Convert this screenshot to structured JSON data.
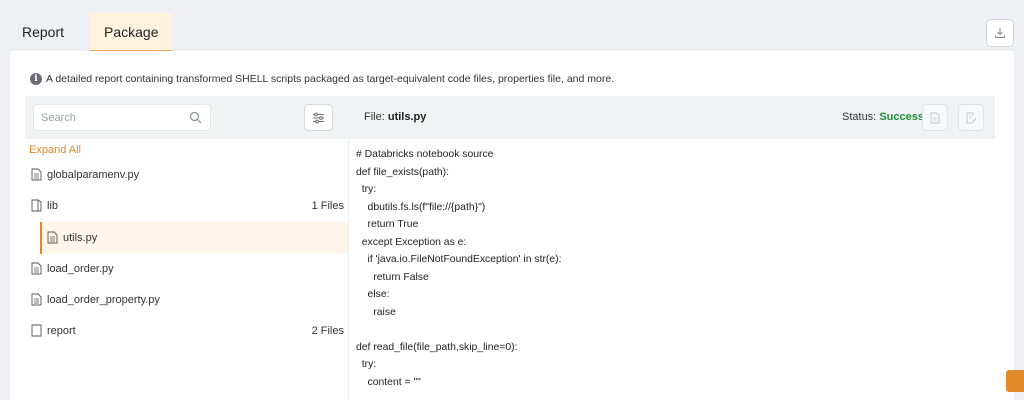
{
  "tabs": [
    {
      "label": "Report",
      "active": false
    },
    {
      "label": "Package",
      "active": true
    }
  ],
  "info_text": "A detailed report containing transformed SHELL scripts packaged as target-equivalent code files, properties file, and more.",
  "search": {
    "placeholder": "Search",
    "value": ""
  },
  "file": {
    "label": "File:",
    "name": "utils.py"
  },
  "status": {
    "label": "Status:",
    "value": "Success",
    "color": "#1f8f3a"
  },
  "tree": {
    "expand_all": "Expand All",
    "items": [
      {
        "name": "globalparamenv.py",
        "type": "file",
        "count": ""
      },
      {
        "name": "lib",
        "type": "folder",
        "count": "1 Files"
      },
      {
        "name": "utils.py",
        "type": "file",
        "count": "",
        "selected": true,
        "indent": 1
      },
      {
        "name": "load_order.py",
        "type": "file",
        "count": ""
      },
      {
        "name": "load_order_property.py",
        "type": "file",
        "count": ""
      },
      {
        "name": "report",
        "type": "folder",
        "count": "2 Files"
      }
    ]
  },
  "code": "# Databricks notebook source\ndef file_exists(path):\n  try:\n    dbutils.fs.ls(f\"file://{path}\")\n    return True\n  except Exception as e:\n    if 'java.io.FileNotFoundException' in str(e):\n      return False\n    else:\n      raise\n\ndef read_file(file_path,skip_line=0):\n  try:\n    content = \"\"",
  "colors": {
    "accent": "#e2892a",
    "success": "#1f8f3a"
  },
  "icons": {
    "download": "download-icon",
    "search": "search-icon",
    "filter": "sliders-icon",
    "info": "info-icon",
    "file": "file-icon",
    "folder": "folder-icon"
  }
}
